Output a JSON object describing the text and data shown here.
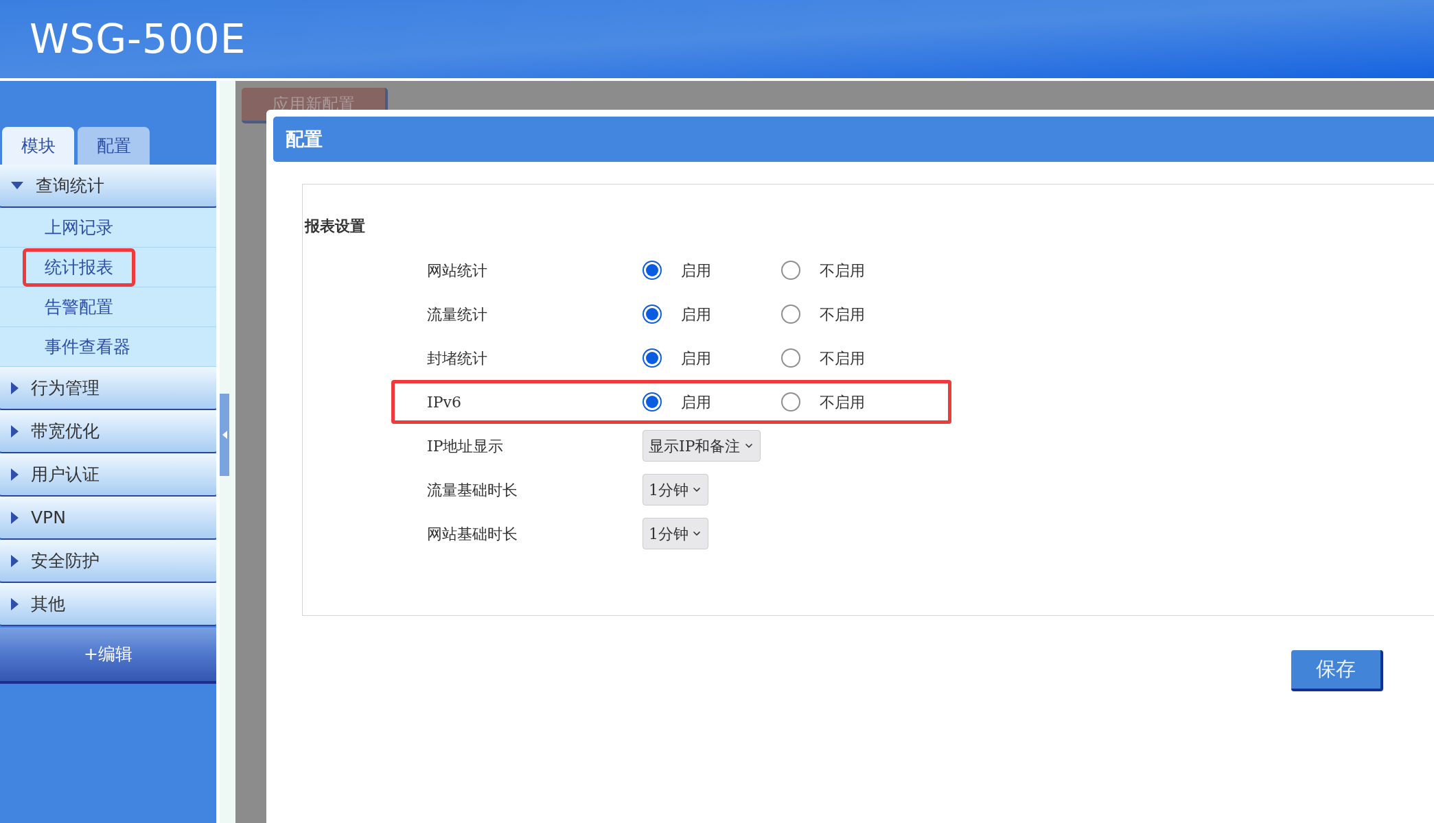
{
  "header": {
    "title": "WSG-500E"
  },
  "sidebar": {
    "tabs": [
      {
        "label": "模块",
        "selected": true
      },
      {
        "label": "配置",
        "selected": false
      }
    ],
    "groups": [
      {
        "label": "查询统计",
        "expanded": true,
        "children": [
          {
            "label": "上网记录",
            "highlighted": false
          },
          {
            "label": "统计报表",
            "highlighted": true
          },
          {
            "label": "告警配置",
            "highlighted": false
          },
          {
            "label": "事件查看器",
            "highlighted": false
          }
        ]
      },
      {
        "label": "行为管理",
        "expanded": false
      },
      {
        "label": "带宽优化",
        "expanded": false
      },
      {
        "label": "用户认证",
        "expanded": false
      },
      {
        "label": "VPN",
        "expanded": false
      },
      {
        "label": "安全防护",
        "expanded": false
      },
      {
        "label": "其他",
        "expanded": false
      }
    ],
    "edit_button": "+编辑"
  },
  "background": {
    "apply_button": "应用新配置"
  },
  "dialog": {
    "title": "配置",
    "section": "报表设置",
    "rows": [
      {
        "kind": "radio",
        "label": "网站统计",
        "highlighted": false,
        "options": [
          {
            "label": "启用",
            "selected": true
          },
          {
            "label": "不启用",
            "selected": false
          }
        ]
      },
      {
        "kind": "radio",
        "label": "流量统计",
        "highlighted": false,
        "options": [
          {
            "label": "启用",
            "selected": true
          },
          {
            "label": "不启用",
            "selected": false
          }
        ]
      },
      {
        "kind": "radio",
        "label": "封堵统计",
        "highlighted": false,
        "options": [
          {
            "label": "启用",
            "selected": true
          },
          {
            "label": "不启用",
            "selected": false
          }
        ]
      },
      {
        "kind": "radio",
        "label": "IPv6",
        "highlighted": true,
        "options": [
          {
            "label": "启用",
            "selected": true
          },
          {
            "label": "不启用",
            "selected": false
          }
        ]
      },
      {
        "kind": "select",
        "label": "IP地址显示",
        "value": "显示IP和备注"
      },
      {
        "kind": "select",
        "label": "流量基础时长",
        "value": "1分钟"
      },
      {
        "kind": "select",
        "label": "网站基础时长",
        "value": "1分钟"
      }
    ],
    "save_button": "保存"
  }
}
